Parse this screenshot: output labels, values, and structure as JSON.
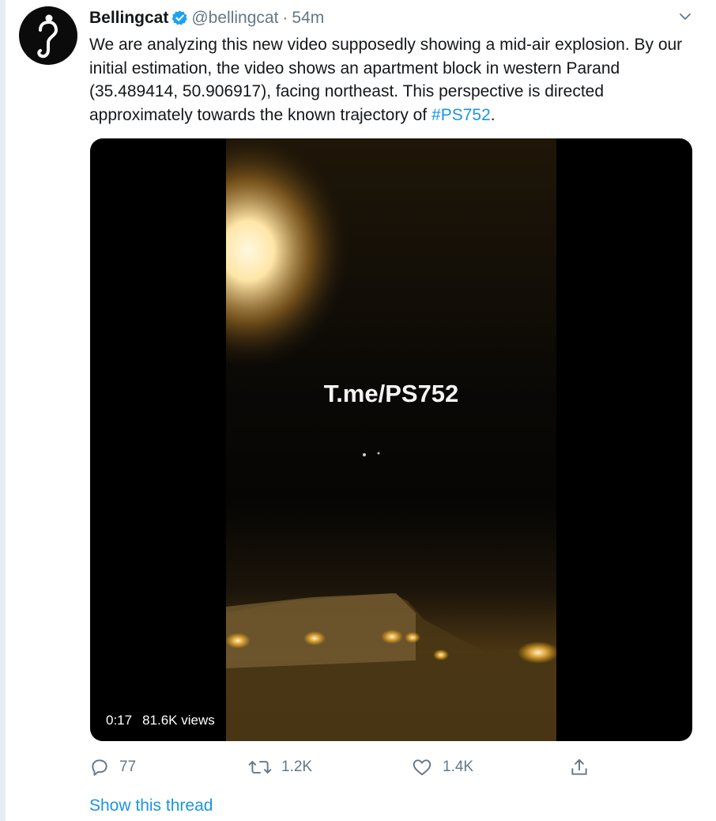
{
  "author": {
    "name": "Bellingcat",
    "handle": "@bellingcat",
    "separator": "·",
    "time": "54m",
    "verified": true,
    "avatar_icon": "question-hook-icon"
  },
  "tweet": {
    "text_before": "We are analyzing this new video supposedly showing a mid-air explosion. By our initial estimation, the video shows an apartment block in western Parand (35.489414, 50.906917), facing northeast. This perspective is directed approximately towards the known trajectory of ",
    "hashtag": "#PS752",
    "text_after": "."
  },
  "media": {
    "watermark": "T.me/PS752",
    "duration": "0:17",
    "views": "81.6K views"
  },
  "actions": {
    "reply_count": "77",
    "retweet_count": "1.2K",
    "like_count": "1.4K"
  },
  "show_thread_label": "Show this thread",
  "colors": {
    "link": "#1b95e0",
    "secondary_text": "#657786",
    "primary_text": "#14171a"
  }
}
